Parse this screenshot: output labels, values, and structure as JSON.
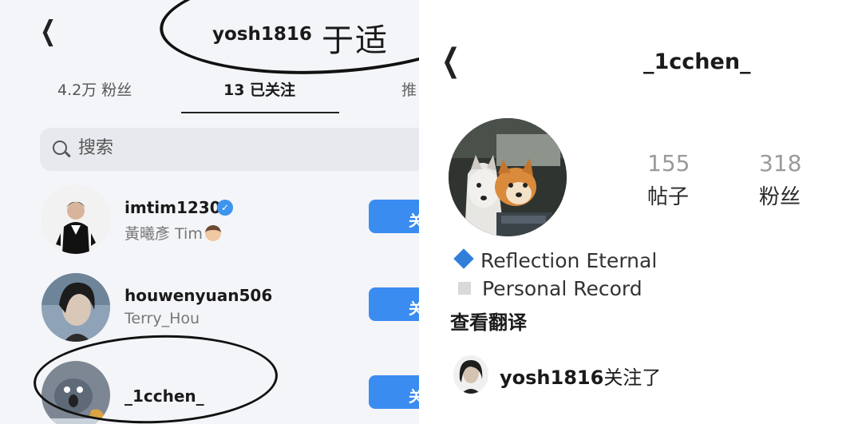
{
  "left": {
    "username": "yosh1816",
    "annotation": "于适",
    "tabs": {
      "followers": "4.2万 粉丝",
      "following": "13 已关注",
      "recommend": "推"
    },
    "search_placeholder": "搜索",
    "follow_label": "关",
    "rows": [
      {
        "username": "imtim1230",
        "fullname": "黃曦彥 Tim",
        "verified": true
      },
      {
        "username": "houwenyuan506",
        "fullname": "Terry_Hou",
        "verified": false
      },
      {
        "username": "_1cchen_",
        "fullname": "",
        "verified": false
      }
    ]
  },
  "right": {
    "username": "_1cchen_",
    "stats": [
      {
        "value": "155",
        "label": "帖子"
      },
      {
        "value": "318",
        "label": "粉丝"
      }
    ],
    "bio": [
      "Reflection Eternal",
      "Personal Record"
    ],
    "translate": "查看翻译",
    "followed_by_user": "yosh1816",
    "followed_by_suffix": "关注了"
  },
  "colors": {
    "follow_button": "#3b8cf0",
    "verified_badge": "#3d95ef",
    "bio_diamond": "#2f7fd9"
  }
}
